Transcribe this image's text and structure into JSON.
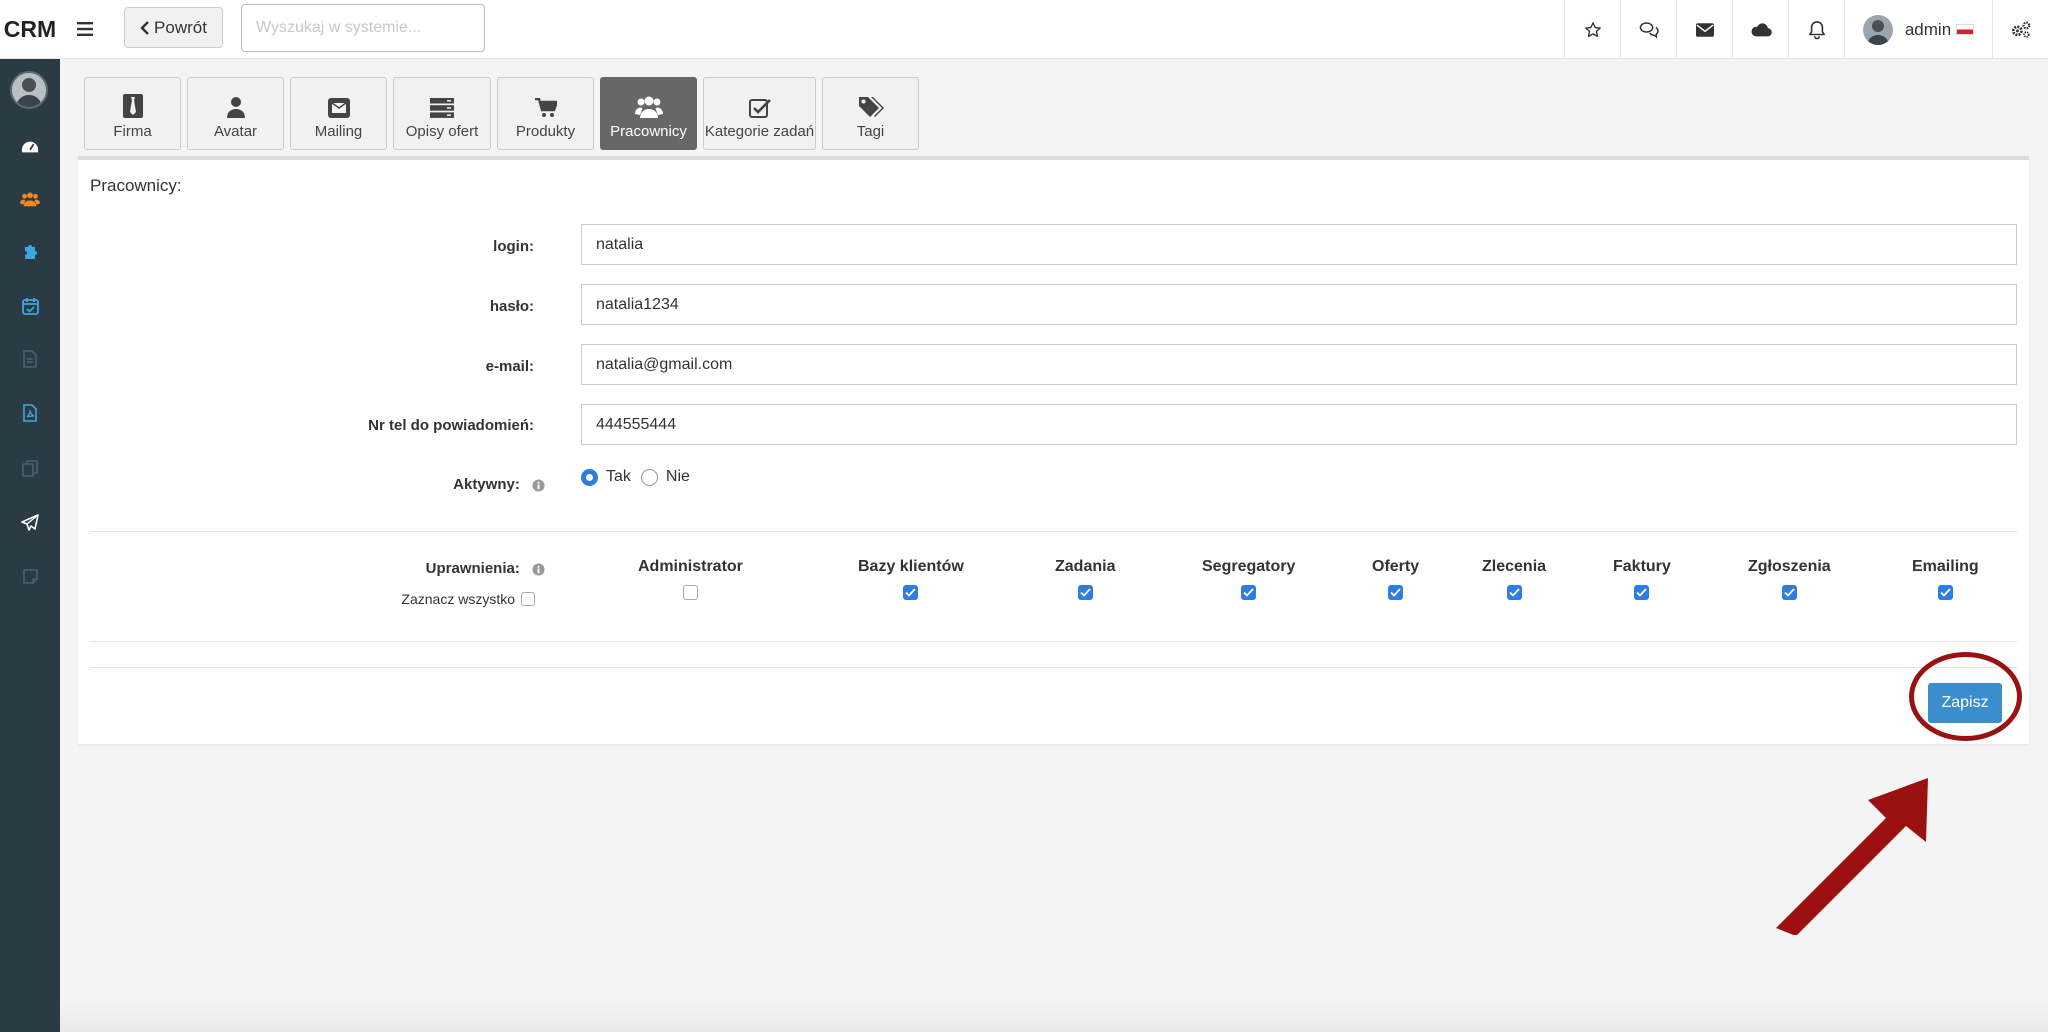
{
  "app": {
    "logo": "CRM"
  },
  "header": {
    "back_label": "Powrót",
    "search_placeholder": "Wyszukaj w systemie...",
    "user_name": "admin",
    "icons": [
      "star-icon",
      "chat-icon",
      "envelope-icon",
      "cloud-icon",
      "bell-icon",
      "cogs-icon"
    ]
  },
  "sidebar": {
    "icons": [
      "dashboard-icon",
      "users-icon",
      "puzzle-icon",
      "calendar-check-icon",
      "file-icon",
      "file-pdf-icon",
      "copy-icon",
      "paper-plane-icon",
      "note-icon"
    ],
    "colors": {
      "background": "#2a3b44",
      "accent": "#3ea6e0",
      "orange": "#f08a24"
    }
  },
  "tabs": [
    {
      "label": "Firma",
      "icon": "tie-icon"
    },
    {
      "label": "Avatar",
      "icon": "user-icon"
    },
    {
      "label": "Mailing",
      "icon": "envelope-square-icon"
    },
    {
      "label": "Opisy ofert",
      "icon": "server-icon"
    },
    {
      "label": "Produkty",
      "icon": "cart-icon"
    },
    {
      "label": "Pracownicy",
      "icon": "users-icon",
      "active": true
    },
    {
      "label": "Kategorie zadań",
      "icon": "check-square-icon"
    },
    {
      "label": "Tagi",
      "icon": "tags-icon"
    }
  ],
  "form": {
    "title": "Pracownicy:",
    "login_label": "login:",
    "login_value": "natalia",
    "password_label": "hasło:",
    "password_value": "natalia1234",
    "email_label": "e-mail:",
    "email_value": "natalia@gmail.com",
    "phone_label": "Nr tel do powiadomień:",
    "phone_value": "444555444",
    "active_label": "Aktywny:",
    "active_yes": "Tak",
    "active_no": "Nie",
    "active_selected": "Tak",
    "permissions_label": "Uprawnienia:",
    "select_all_label": "Zaznacz wszystko",
    "permissions": [
      {
        "label": "Administrator",
        "checked": false
      },
      {
        "label": "Bazy klientów",
        "checked": true
      },
      {
        "label": "Zadania",
        "checked": true
      },
      {
        "label": "Segregatory",
        "checked": true
      },
      {
        "label": "Oferty",
        "checked": true
      },
      {
        "label": "Zlecenia",
        "checked": true
      },
      {
        "label": "Faktury",
        "checked": true
      },
      {
        "label": "Zgłoszenia",
        "checked": true
      },
      {
        "label": "Emailing",
        "checked": true
      }
    ],
    "save_label": "Zapisz"
  },
  "colors": {
    "primary": "#3a8ecb",
    "checkbox": "#2f7de1",
    "annotation": "#9b1010",
    "active_tab": "#676767"
  }
}
